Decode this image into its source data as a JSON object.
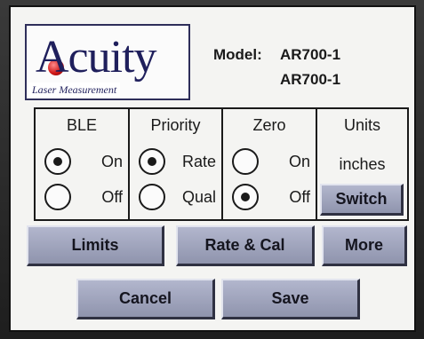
{
  "logo": {
    "word": "Acuity",
    "tagline": "Laser Measurement"
  },
  "model": {
    "label": "Model:",
    "value_1": "AR700-1",
    "value_2": "AR700-1"
  },
  "settings": {
    "ble": {
      "title": "BLE",
      "options": [
        {
          "label": "On",
          "selected": true
        },
        {
          "label": "Off",
          "selected": false
        }
      ]
    },
    "priority": {
      "title": "Priority",
      "options": [
        {
          "label": "Rate",
          "selected": true
        },
        {
          "label": "Qual",
          "selected": false
        }
      ]
    },
    "zero": {
      "title": "Zero",
      "options": [
        {
          "label": "On",
          "selected": false
        },
        {
          "label": "Off",
          "selected": true
        }
      ]
    },
    "units": {
      "title": "Units",
      "value": "inches",
      "switch_label": "Switch"
    }
  },
  "buttons": {
    "limits": "Limits",
    "rate_cal": "Rate & Cal",
    "more": "More",
    "cancel": "Cancel",
    "save": "Save"
  },
  "colors": {
    "button_face": "#9ea3bd",
    "screen_bg": "#f4f4f2",
    "logo_text": "#1f1f5c",
    "logo_accent": "#d01818"
  }
}
